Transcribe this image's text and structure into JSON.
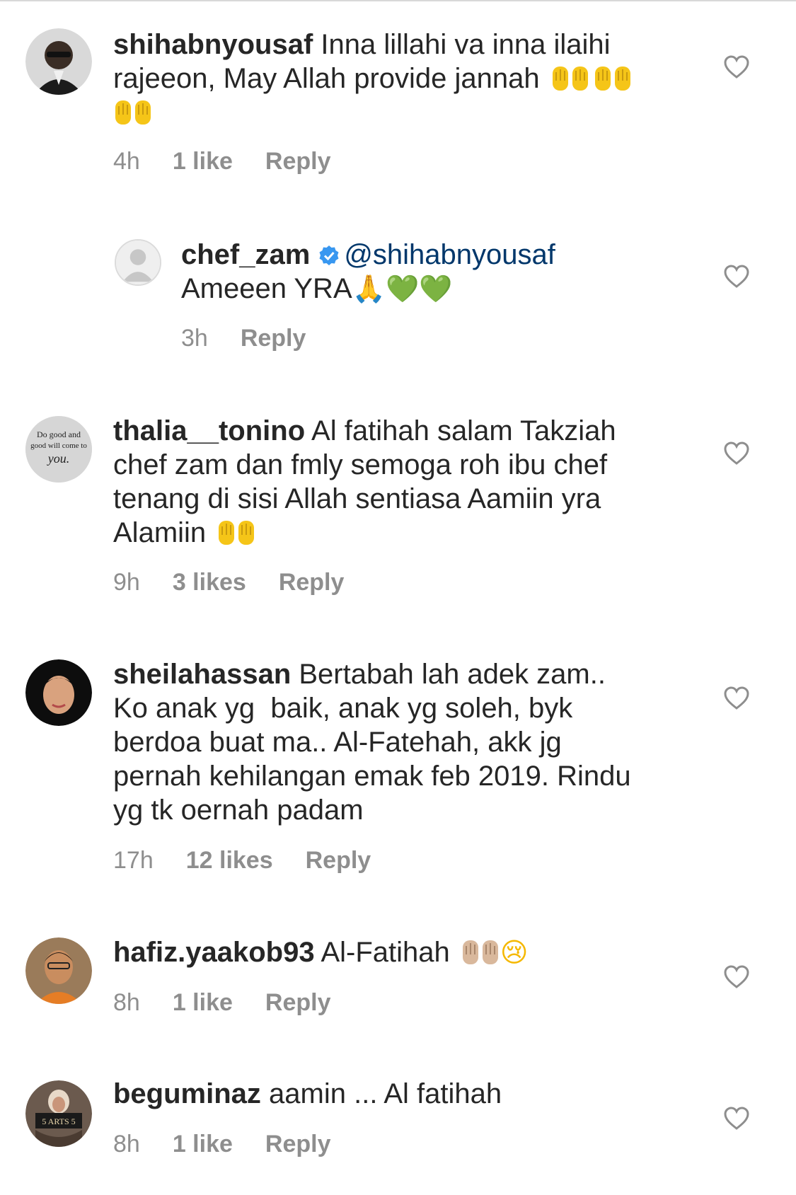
{
  "comments": [
    {
      "username": "shihabnyousaf",
      "text_line1": "Inna lillahi va inna ilaihi",
      "text_line2": "rajeeon, May Allah provide jannah",
      "time": "4h",
      "likes": "1 like",
      "reply": "Reply"
    },
    {
      "username": "chef_zam",
      "mention": "@shihabnyousaf",
      "text": "Ameeen YRA",
      "emoji_pray": "🙏",
      "emoji_heart1": "💚",
      "emoji_heart2": "💚",
      "time": "3h",
      "reply": "Reply"
    },
    {
      "username": "thalia__tonino",
      "avatar_text1": "Do good and",
      "avatar_text2": "good will come to",
      "avatar_text3": "you.",
      "text_line1": "Al fatihah salam Takziah",
      "text_line2": "chef zam dan fmly semoga roh ibu chef",
      "text_line3": "tenang di sisi Allah sentiasa Aamiin yra",
      "text_line4": "Alamiin",
      "time": "9h",
      "likes": "3 likes",
      "reply": "Reply"
    },
    {
      "username": "sheilahassan",
      "text_line1": "Bertabah lah adek zam..",
      "text_line2": "Ko anak yg  baik, anak yg soleh, byk",
      "text_line3": "berdoa buat ma.. Al-Fatehah, akk jg",
      "text_line4": "pernah kehilangan emak feb 2019. Rindu",
      "text_line5": "yg tk oernah padam",
      "time": "17h",
      "likes": "12 likes",
      "reply": "Reply"
    },
    {
      "username": "hafiz.yaakob93",
      "text": "Al-Fatihah",
      "emoji_cry": "😢",
      "time": "8h",
      "likes": "1 like",
      "reply": "Reply"
    },
    {
      "username": "beguminaz",
      "avatar_text": "5 ARTS 5",
      "text": "aamin ... Al fatihah",
      "time": "8h",
      "likes": "1 like",
      "reply": "Reply"
    }
  ],
  "colors": {
    "text": "#262626",
    "meta": "#8e8e8e",
    "mention": "#00376b",
    "verified": "#3897f0",
    "heart_outline": "#8e8e8e",
    "emoji_hand": "#f5c518",
    "emoji_hand_light": "#d9b89c",
    "emoji_green_heart": "#3fbf3f"
  },
  "icons": {
    "like": "heart-outline-icon",
    "verified": "verified-badge-icon",
    "avatar_placeholder": "default-avatar-icon"
  }
}
